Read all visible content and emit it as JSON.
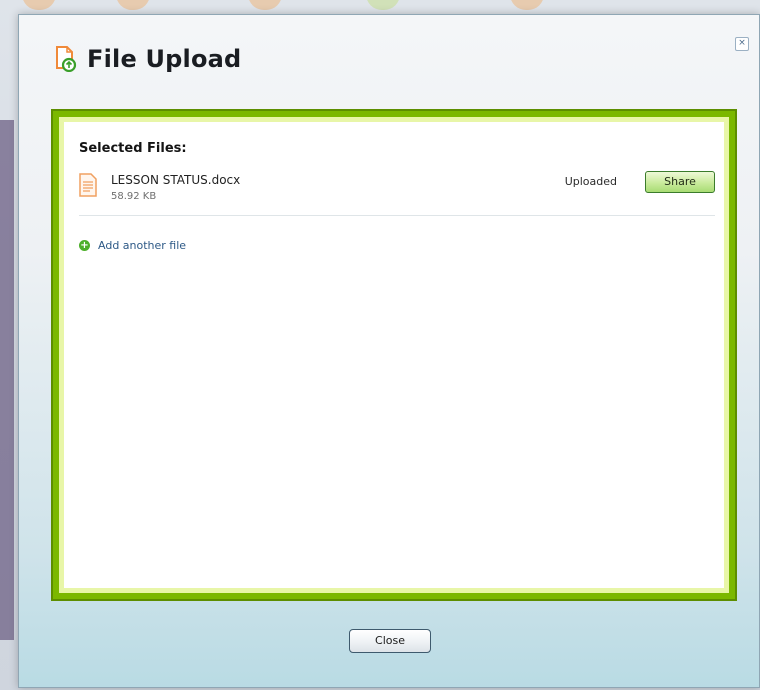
{
  "dialog": {
    "title": "File Upload",
    "close_x": "×",
    "title_icon": "upload-document-icon",
    "close_button_label": "Close"
  },
  "panel": {
    "selected_files_label": "Selected Files:",
    "files": [
      {
        "name": "LESSON STATUS.docx",
        "size": "58.92 KB",
        "status": "Uploaded",
        "action_label": "Share",
        "icon": "document-icon"
      }
    ],
    "add_another_label": "Add another file",
    "add_icon": "plus-circle-icon"
  },
  "colors": {
    "panel_border": "#7bb800",
    "panel_glow": "#e8f6a8",
    "share_button": "#a8dc74",
    "add_icon": "#4caf2a",
    "link_text": "#2e5a87",
    "title_icon_orange": "#f08a3a",
    "title_icon_green": "#3a9f2a"
  }
}
